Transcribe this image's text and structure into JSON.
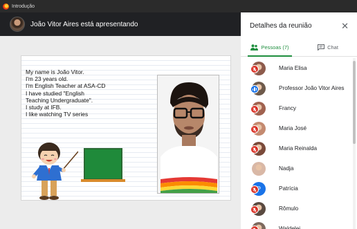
{
  "window": {
    "title": "Introdução"
  },
  "presenter": {
    "label": "João Vitor Aires está apresentando"
  },
  "slide": {
    "lines": [
      "My name is João Vitor.",
      "I'm 23 years old.",
      "I'm English Teacher at ASA-CD",
      "I have studied \"English",
      "Teaching Undergraduate\".",
      "I study at IFB.",
      "I like watching TV series"
    ]
  },
  "panel": {
    "title": "Detalhes da reunião",
    "close_icon": "close-icon",
    "tabs": [
      {
        "label": "Pessoas (7)",
        "icon": "people-icon",
        "active": true
      },
      {
        "label": "Chat",
        "icon": "chat-icon",
        "active": false
      }
    ]
  },
  "people": [
    {
      "name": "Maria Elisa",
      "status": "muted",
      "avatar_color": "#8d5b4c"
    },
    {
      "name": "Professor João Vitor Aires",
      "status": "speaking",
      "avatar_color": "#6e5a4b"
    },
    {
      "name": "Francy",
      "status": "muted",
      "avatar_color": "#a0624f"
    },
    {
      "name": "Maria José",
      "status": "muted",
      "avatar_color": "#c48a70"
    },
    {
      "name": "Maria Reinalda",
      "status": "muted",
      "avatar_color": "#7a4a3a"
    },
    {
      "name": "Nadja",
      "status": "idle",
      "avatar_color": "#d9b8a6"
    },
    {
      "name": "Patrícia",
      "status": "muted",
      "avatar_color": "#1a73e8",
      "initial": "P"
    },
    {
      "name": "Rômulo",
      "status": "muted",
      "avatar_color": "#5a4a40"
    },
    {
      "name": "Waldelei",
      "status": "muted",
      "avatar_color": "#7d6a5e"
    }
  ],
  "colors": {
    "accent": "#1e8e3e",
    "muted": "#d93025",
    "speaking": "#1a73e8"
  }
}
